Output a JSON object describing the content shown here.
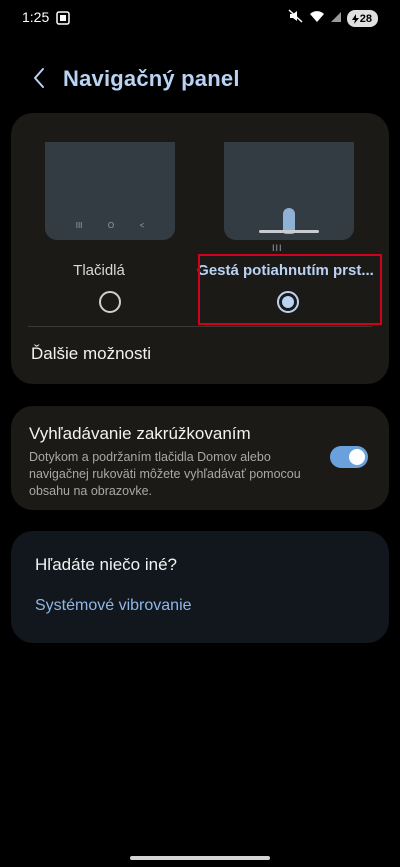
{
  "status_bar": {
    "time": "1:25",
    "battery": "28",
    "icons": [
      "screenshot-icon",
      "mute-icon",
      "wifi-icon",
      "signal-icon",
      "battery-icon"
    ]
  },
  "header": {
    "back_icon": "chevron-left-icon",
    "title": "Navigačný panel"
  },
  "nav_type": {
    "options": [
      {
        "label": "Tlačidlá",
        "selected": false
      },
      {
        "label": "Gestá potiahnutím prst...",
        "selected": true
      }
    ],
    "preview_buttons_glyphs": [
      "III",
      "O",
      "<"
    ],
    "gesture_hint": "III"
  },
  "more_options_label": "Ďalšie možnosti",
  "circle_to_search": {
    "title": "Vyhľadávanie zakrúžkovaním",
    "description": "Dotykom a podržaním tlačidla Domov alebo navigačnej rukoväti môžete vyhľadávať pomocou obsahu na obrazovke.",
    "enabled": true
  },
  "looking_for_else": {
    "title": "Hľadáte niečo iné?",
    "link": "Systémové vibrovanie"
  },
  "colors": {
    "accent": "#b9d3f5",
    "toggle_on": "#6aa0dc",
    "highlight": "#d0021b",
    "card": "#1c1a17"
  }
}
